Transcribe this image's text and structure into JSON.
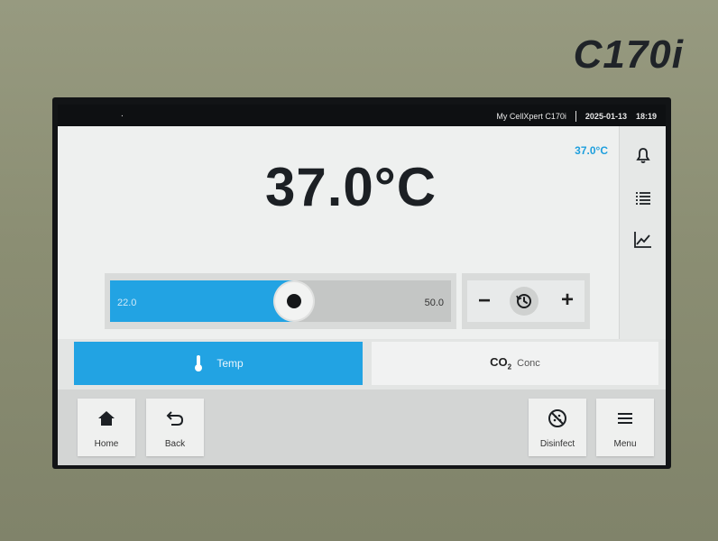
{
  "device": {
    "model": "C170i"
  },
  "statusbar": {
    "dot": ".",
    "device_name": "My CellXpert C170i",
    "date": "2025-01-13",
    "time": "18:19"
  },
  "main": {
    "setpoint_label": "37.0°C",
    "current_temperature": "37.0°C"
  },
  "slider": {
    "min_label": "22.0",
    "max_label": "50.0",
    "level_fraction": 0.54
  },
  "stepper": {
    "minus": "−",
    "plus": "+"
  },
  "sidebar": {
    "icons": [
      "bell-icon",
      "list-icon",
      "chart-icon"
    ]
  },
  "tabs": [
    {
      "label": "Temp",
      "icon": "thermometer-icon",
      "active": true
    },
    {
      "co2_main": "CO",
      "co2_sub": "2",
      "label": "Conc",
      "active": false
    }
  ],
  "bottom": {
    "home": "Home",
    "back": "Back",
    "disinfect": "Disinfect",
    "menu": "Menu"
  },
  "colors": {
    "accent": "#22a3e3",
    "setpoint_text": "#1e9fdd"
  }
}
